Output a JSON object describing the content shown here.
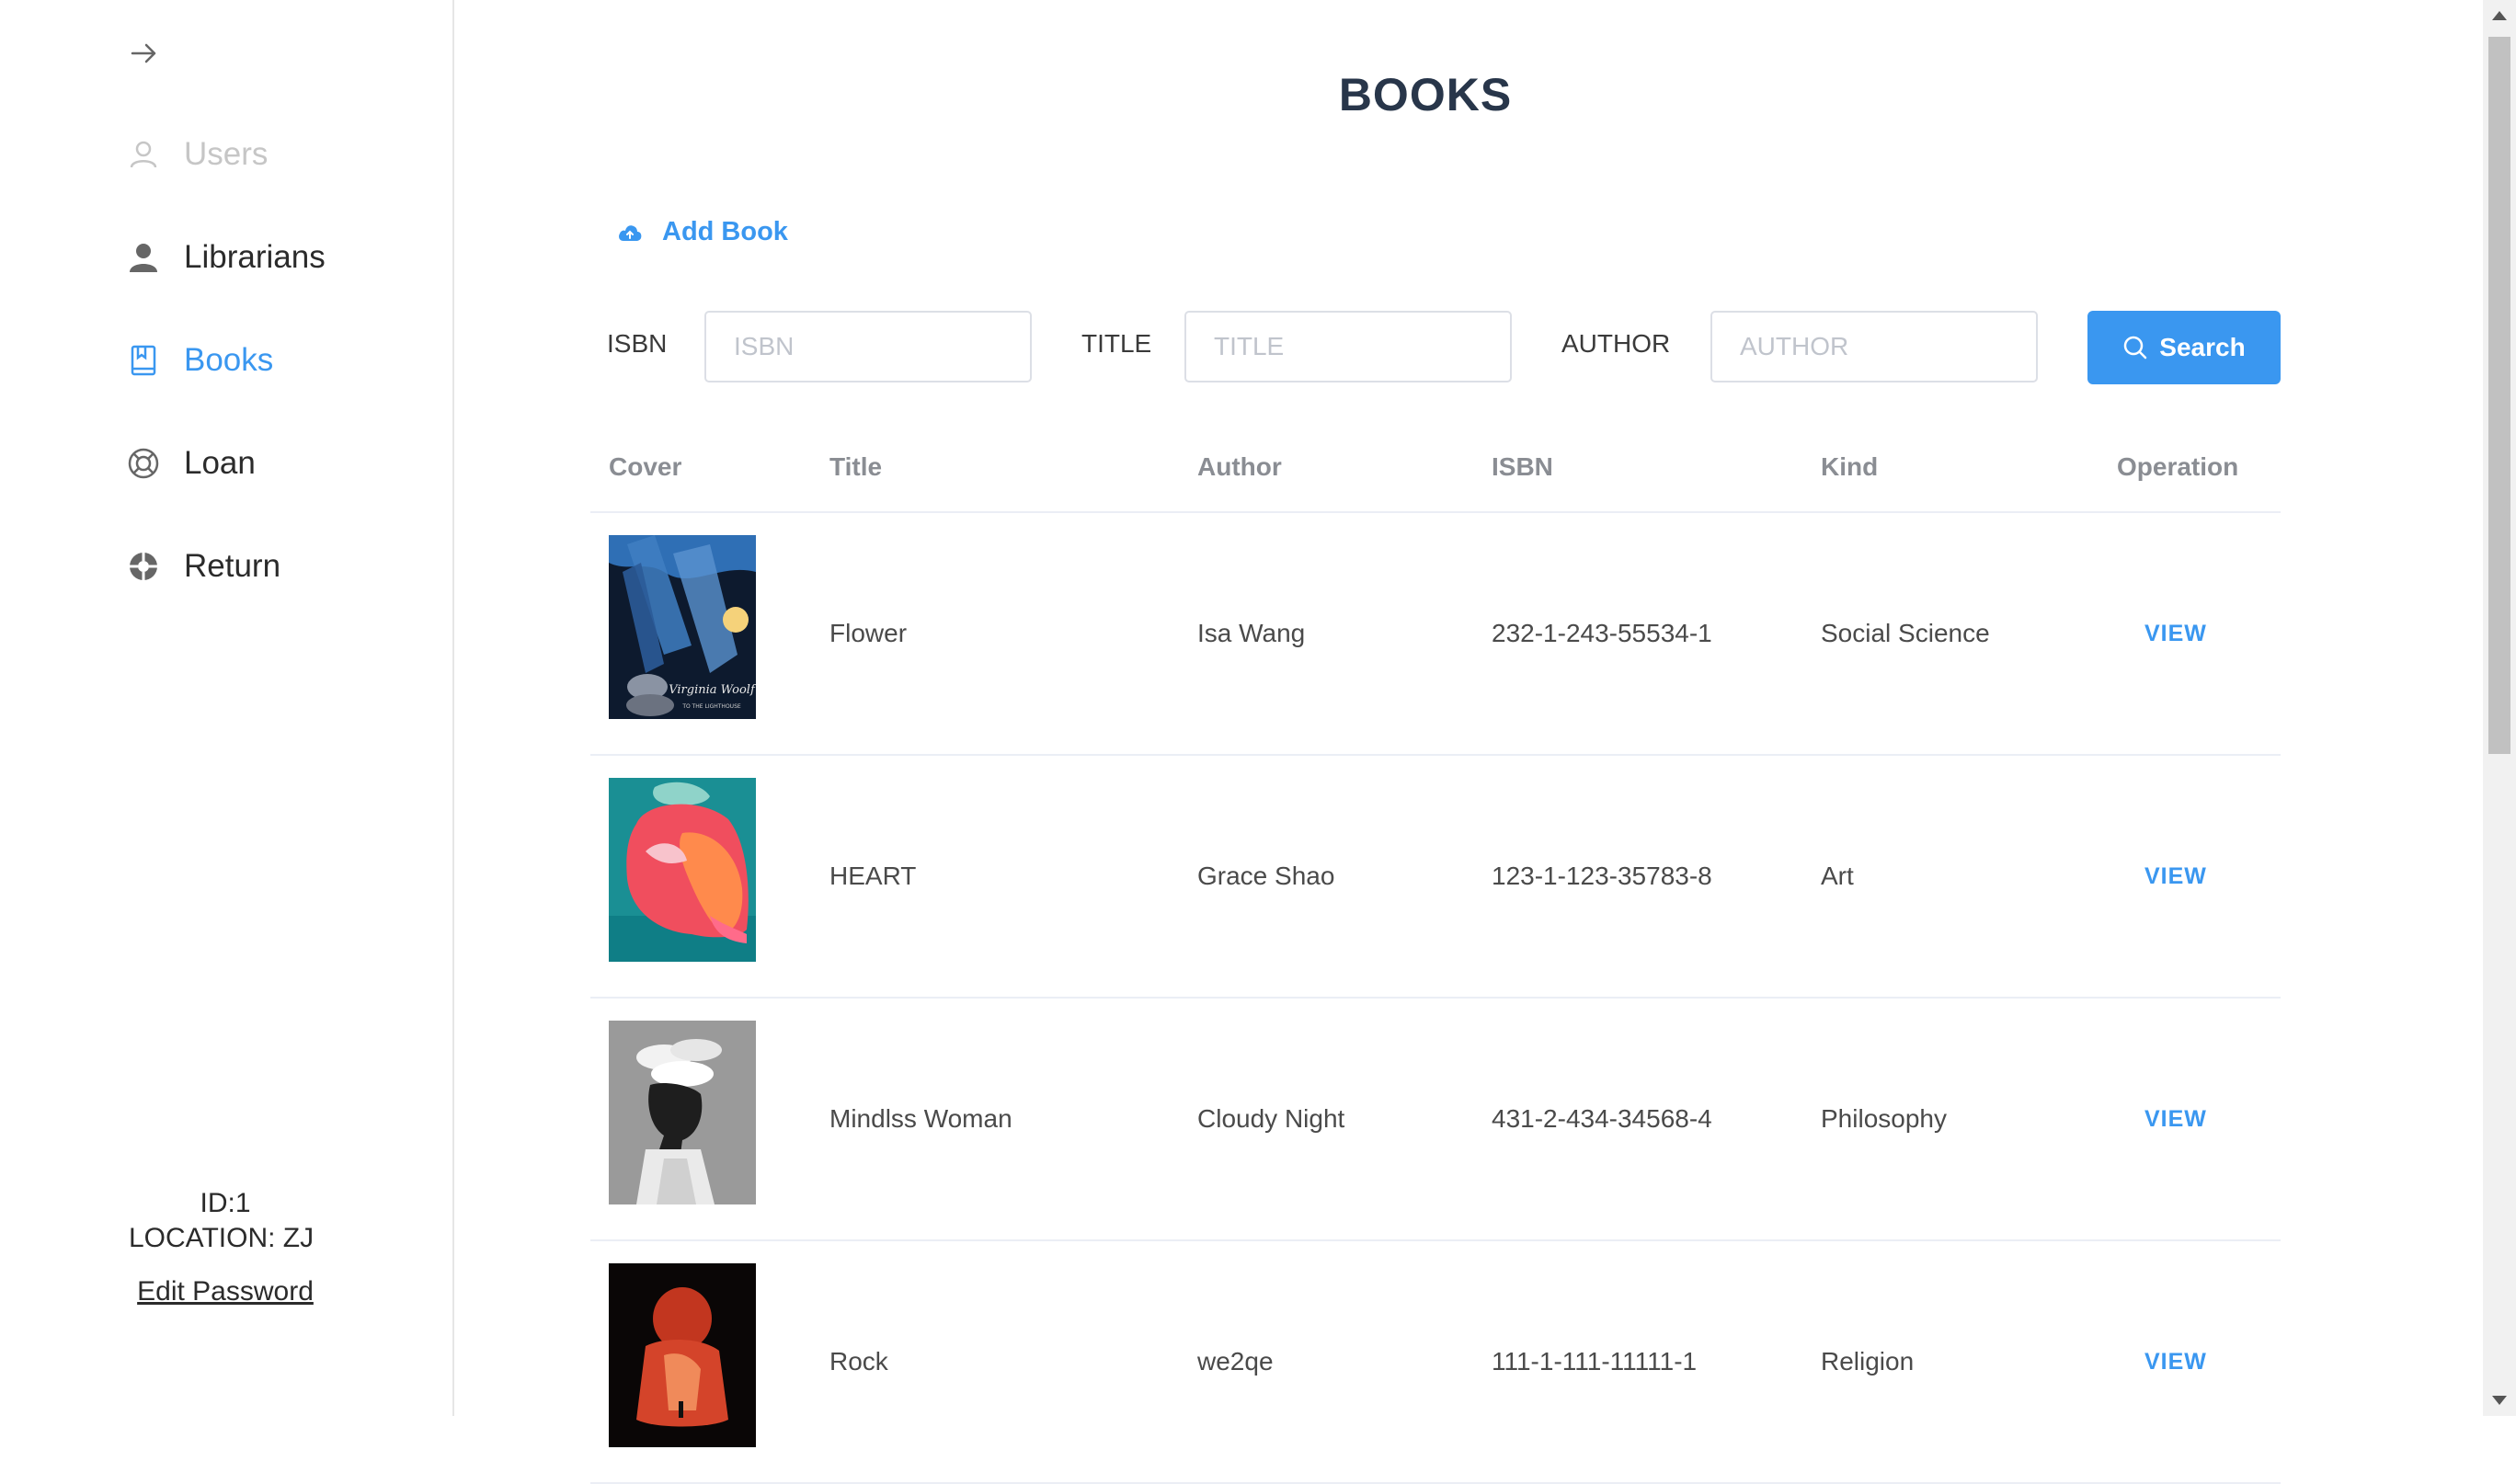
{
  "sidebar": {
    "collapse_icon": "arrow-right-icon",
    "items": [
      {
        "label": "Users",
        "icon": "user-outline-icon",
        "state": "disabled"
      },
      {
        "label": "Librarians",
        "icon": "user-icon",
        "state": "normal"
      },
      {
        "label": "Books",
        "icon": "book-icon",
        "state": "active"
      },
      {
        "label": "Loan",
        "icon": "lifebuoy-icon",
        "state": "normal"
      },
      {
        "label": "Return",
        "icon": "return-icon",
        "state": "normal"
      }
    ],
    "footer": {
      "id": "ID:1",
      "location": "LOCATION: ZJ",
      "edit_password": "Edit Password"
    }
  },
  "main": {
    "title": "BOOKS",
    "add_book": "Add Book",
    "filters": {
      "isbn_label": "ISBN",
      "isbn_placeholder": "ISBN",
      "title_label": "TITLE",
      "title_placeholder": "TITLE",
      "author_label": "AUTHOR",
      "author_placeholder": "AUTHOR",
      "search_label": "Search"
    },
    "table": {
      "headers": [
        "Cover",
        "Title",
        "Author",
        "ISBN",
        "Kind",
        "Operation"
      ],
      "rows": [
        {
          "title": "Flower",
          "author": "Isa Wang",
          "isbn": "232-1-243-55534-1",
          "kind": "Social Science",
          "operation": "VIEW",
          "cover_text": "Virginia Woolf",
          "cover_subtext": "TO THE LIGHTHOUSE"
        },
        {
          "title": "HEART",
          "author": "Grace Shao",
          "isbn": "123-1-123-35783-8",
          "kind": "Art",
          "operation": "VIEW"
        },
        {
          "title": "Mindlss Woman",
          "author": "Cloudy Night",
          "isbn": "431-2-434-34568-4",
          "kind": "Philosophy",
          "operation": "VIEW"
        },
        {
          "title": "Rock",
          "author": "we2qe",
          "isbn": "111-1-111-11111-1",
          "kind": "Religion",
          "operation": "VIEW"
        }
      ]
    }
  },
  "colors": {
    "accent": "#3a97f0",
    "title": "#28364a",
    "border": "#ebeef5"
  }
}
